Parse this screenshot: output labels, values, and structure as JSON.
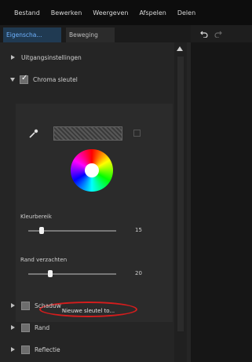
{
  "menubar": {
    "items": [
      "Bestand",
      "Bewerken",
      "Weergeven",
      "Afspelen",
      "Delen"
    ]
  },
  "tabs": [
    {
      "label": "Eigenscha...",
      "active": true
    },
    {
      "label": "Beweging",
      "active": false
    }
  ],
  "properties": {
    "uitgangs_label": "Uitgangsinstellingen",
    "chroma_label": "Chroma sleutel",
    "chroma_checked": true,
    "panel": {
      "kleurbereik_label": "Kleurbereik",
      "kleurbereik_value": "15",
      "kleurbereik_fraction": 0.15,
      "rand_label": "Rand verzachten",
      "rand_value": "20",
      "rand_fraction": 0.25,
      "new_key_button": "Nieuwe sleutel to..."
    },
    "schaduw_label": "Schaduw",
    "rand_section_label": "Rand",
    "reflectie_label": "Reflectie"
  },
  "colors": {
    "active_tab": "#203a52",
    "active_tab_text": "#6fb3ff",
    "annotation": "#d51d1d"
  }
}
